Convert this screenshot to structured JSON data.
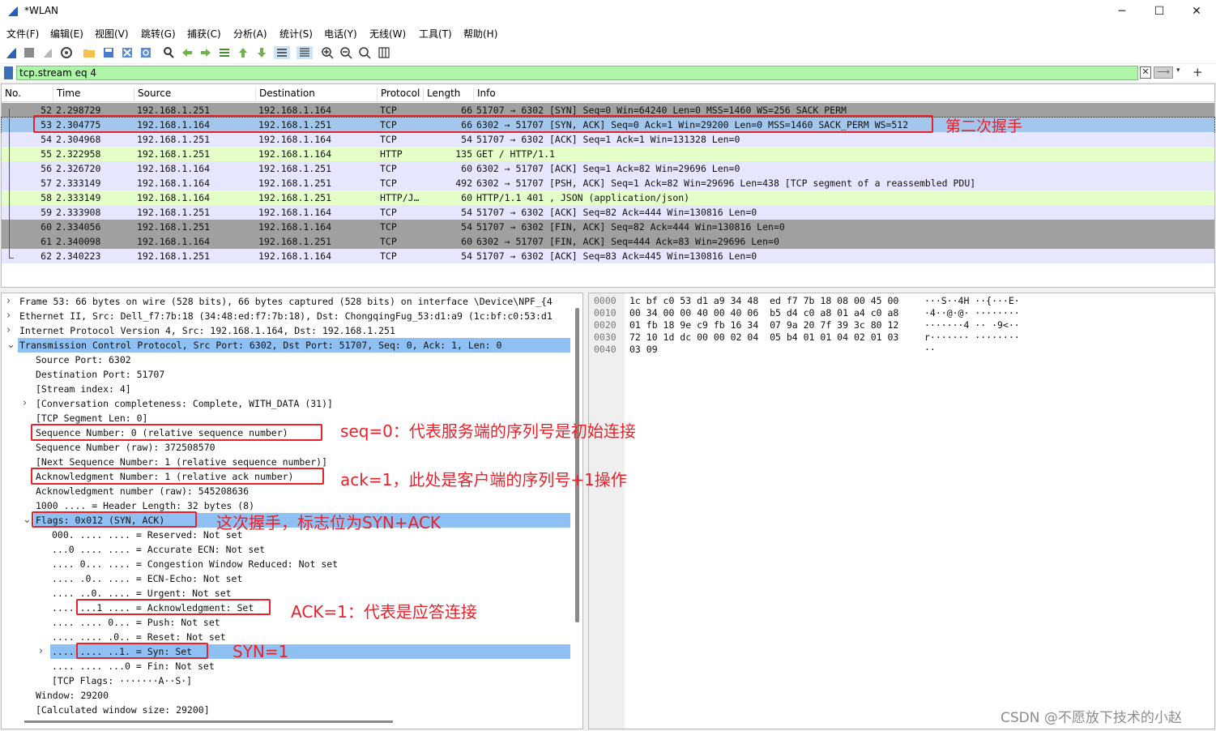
{
  "window": {
    "title": "*WLAN",
    "minimize": "─",
    "maximize": "☐",
    "close": "✕"
  },
  "menu": [
    "文件(F)",
    "编辑(E)",
    "视图(V)",
    "跳转(G)",
    "捕获(C)",
    "分析(A)",
    "统计(S)",
    "电话(Y)",
    "无线(W)",
    "工具(T)",
    "帮助(H)"
  ],
  "toolbar_icons": [
    "shark-fin-start-icon",
    "stop-icon",
    "restart-icon",
    "capture-options-icon",
    "open-folder-icon",
    "save-icon",
    "close-file-icon",
    "reload-icon",
    "find-icon",
    "go-back-icon",
    "go-forward-icon",
    "go-to-packet-icon",
    "go-first-icon",
    "go-last-icon",
    "autoscroll-icon",
    "colorize-icon",
    "zoom-in-icon",
    "zoom-out-icon",
    "zoom-reset-icon",
    "resize-columns-icon"
  ],
  "filter": {
    "value": "tcp.stream eq 4",
    "clear": "✕",
    "apply": "⟶",
    "dropdown": "▾",
    "add": "+"
  },
  "columns": [
    "No.",
    "Time",
    "Source",
    "Destination",
    "Protocol",
    "Length",
    "Info"
  ],
  "packets": [
    {
      "no": "52",
      "time": "2.298729",
      "src": "192.168.1.251",
      "dst": "192.168.1.164",
      "proto": "TCP",
      "len": "66",
      "info": "51707 → 6302 [SYN] Seq=0 Win=64240 Len=0 MSS=1460 WS=256 SACK_PERM",
      "bg": "#a0a0a0",
      "fg": "#111111"
    },
    {
      "no": "53",
      "time": "2.304775",
      "src": "192.168.1.164",
      "dst": "192.168.1.251",
      "proto": "TCP",
      "len": "66",
      "info": "6302 → 51707 [SYN, ACK] Seq=0 Ack=1 Win=29200 Len=0 MSS=1460 SACK_PERM WS=512",
      "bg": "#a2c6ec",
      "fg": "#111111"
    },
    {
      "no": "54",
      "time": "2.304968",
      "src": "192.168.1.251",
      "dst": "192.168.1.164",
      "proto": "TCP",
      "len": "54",
      "info": "51707 → 6302 [ACK] Seq=1 Ack=1 Win=131328 Len=0",
      "bg": "#e7e6ff",
      "fg": "#111111"
    },
    {
      "no": "55",
      "time": "2.322958",
      "src": "192.168.1.251",
      "dst": "192.168.1.164",
      "proto": "HTTP",
      "len": "135",
      "info": "GET / HTTP/1.1",
      "bg": "#e4ffc7",
      "fg": "#111111"
    },
    {
      "no": "56",
      "time": "2.326720",
      "src": "192.168.1.164",
      "dst": "192.168.1.251",
      "proto": "TCP",
      "len": "60",
      "info": "6302 → 51707 [ACK] Seq=1 Ack=82 Win=29696 Len=0",
      "bg": "#e7e6ff",
      "fg": "#111111"
    },
    {
      "no": "57",
      "time": "2.333149",
      "src": "192.168.1.164",
      "dst": "192.168.1.251",
      "proto": "TCP",
      "len": "492",
      "info": "6302 → 51707 [PSH, ACK] Seq=1 Ack=82 Win=29696 Len=438 [TCP segment of a reassembled PDU]",
      "bg": "#e7e6ff",
      "fg": "#111111"
    },
    {
      "no": "58",
      "time": "2.333149",
      "src": "192.168.1.164",
      "dst": "192.168.1.251",
      "proto": "HTTP/J…",
      "len": "60",
      "info": "HTTP/1.1 401  , JSON (application/json)",
      "bg": "#e4ffc7",
      "fg": "#111111"
    },
    {
      "no": "59",
      "time": "2.333908",
      "src": "192.168.1.251",
      "dst": "192.168.1.164",
      "proto": "TCP",
      "len": "54",
      "info": "51707 → 6302 [ACK] Seq=82 Ack=444 Win=130816 Len=0",
      "bg": "#e7e6ff",
      "fg": "#111111"
    },
    {
      "no": "60",
      "time": "2.334056",
      "src": "192.168.1.251",
      "dst": "192.168.1.164",
      "proto": "TCP",
      "len": "54",
      "info": "51707 → 6302 [FIN, ACK] Seq=82 Ack=444 Win=130816 Len=0",
      "bg": "#a0a0a0",
      "fg": "#111111"
    },
    {
      "no": "61",
      "time": "2.340098",
      "src": "192.168.1.164",
      "dst": "192.168.1.251",
      "proto": "TCP",
      "len": "60",
      "info": "6302 → 51707 [FIN, ACK] Seq=444 Ack=83 Win=29696 Len=0",
      "bg": "#a0a0a0",
      "fg": "#111111"
    },
    {
      "no": "62",
      "time": "2.340223",
      "src": "192.168.1.251",
      "dst": "192.168.1.164",
      "proto": "TCP",
      "len": "54",
      "info": "51707 → 6302 [ACK] Seq=83 Ack=445 Win=130816 Len=0",
      "bg": "#e7e6ff",
      "fg": "#111111"
    }
  ],
  "details": [
    {
      "text": "Frame 53: 66 bytes on wire (528 bits), 66 bytes captured (528 bits) on interface \\Device\\NPF_{4",
      "arrow": "›",
      "selected": false
    },
    {
      "text": "Ethernet II, Src: Dell_f7:7b:18 (34:48:ed:f7:7b:18), Dst: ChongqingFug_53:d1:a9 (1c:bf:c0:53:d1",
      "arrow": "›",
      "selected": false
    },
    {
      "text": "Internet Protocol Version 4, Src: 192.168.1.164, Dst: 192.168.1.251",
      "arrow": "›",
      "selected": false
    },
    {
      "text": "Transmission Control Protocol, Src Port: 6302, Dst Port: 51707, Seq: 0, Ack: 1, Len: 0",
      "arrow": "⌄",
      "selected": true
    },
    {
      "text": "Source Port: 6302",
      "arrow": "",
      "selected": false
    },
    {
      "text": "Destination Port: 51707",
      "arrow": "",
      "selected": false
    },
    {
      "text": "[Stream index: 4]",
      "arrow": "",
      "selected": false
    },
    {
      "text": "[Conversation completeness: Complete, WITH_DATA (31)]",
      "arrow": "›",
      "selected": false
    },
    {
      "text": "[TCP Segment Len: 0]",
      "arrow": "",
      "selected": false
    },
    {
      "text": "Sequence Number: 0    (relative sequence number)",
      "arrow": "",
      "selected": false
    },
    {
      "text": "Sequence Number (raw): 372508570",
      "arrow": "",
      "selected": false
    },
    {
      "text": "[Next Sequence Number: 1    (relative sequence number)]",
      "arrow": "",
      "selected": false
    },
    {
      "text": "Acknowledgment Number: 1    (relative ack number)",
      "arrow": "",
      "selected": false
    },
    {
      "text": "Acknowledgment number (raw): 545208636",
      "arrow": "",
      "selected": false
    },
    {
      "text": "1000 .... = Header Length: 32 bytes (8)",
      "arrow": "",
      "selected": false
    },
    {
      "text": "Flags: 0x012 (SYN, ACK)",
      "arrow": "⌄",
      "selected": true
    },
    {
      "text": "000. .... .... = Reserved: Not set",
      "arrow": "",
      "selected": false
    },
    {
      "text": "...0 .... .... = Accurate ECN: Not set",
      "arrow": "",
      "selected": false
    },
    {
      "text": ".... 0... .... = Congestion Window Reduced: Not set",
      "arrow": "",
      "selected": false
    },
    {
      "text": ".... .0.. .... = ECN-Echo: Not set",
      "arrow": "",
      "selected": false
    },
    {
      "text": ".... ..0. .... = Urgent: Not set",
      "arrow": "",
      "selected": false
    },
    {
      "text": ".... ...1 .... = Acknowledgment: Set",
      "arrow": "",
      "selected": false
    },
    {
      "text": ".... .... 0... = Push: Not set",
      "arrow": "",
      "selected": false
    },
    {
      "text": ".... .... .0.. = Reset: Not set",
      "arrow": "",
      "selected": false
    },
    {
      "text": ".... .... ..1. = Syn: Set",
      "arrow": "›",
      "selected": true
    },
    {
      "text": ".... .... ...0 = Fin: Not set",
      "arrow": "",
      "selected": false
    },
    {
      "text": "[TCP Flags: ·······A··S·]",
      "arrow": "",
      "selected": false
    },
    {
      "text": "Window: 29200",
      "arrow": "",
      "selected": false
    },
    {
      "text": "[Calculated window size: 29200]",
      "arrow": "",
      "selected": false
    }
  ],
  "hex": [
    {
      "offset": "0000",
      "bytes": "1c bf c0 53 d1 a9 34 48  ed f7 7b 18 08 00 45 00",
      "ascii": "···S··4H ··{···E·"
    },
    {
      "offset": "0010",
      "bytes": "00 34 00 00 40 00 40 06  b5 d4 c0 a8 01 a4 c0 a8",
      "ascii": "·4··@·@· ········"
    },
    {
      "offset": "0020",
      "bytes": "01 fb 18 9e c9 fb 16 34  07 9a 20 7f 39 3c 80 12",
      "ascii": "·······4 ·· ·9<··"
    },
    {
      "offset": "0030",
      "bytes": "72 10 1d dc 00 00 02 04  05 b4 01 01 04 02 01 03",
      "ascii": "r······· ········"
    },
    {
      "offset": "0040",
      "bytes": "03 09",
      "ascii": "··"
    }
  ],
  "annotations": {
    "second_handshake": "第二次握手",
    "seq": "seq=0：代表服务端的序列号是初始连接",
    "ack": "ack=1，此处是客户端的序列号+1操作",
    "flags": "这次握手，标志位为SYN+ACK",
    "ack_flag": "ACK=1：代表是应答连接",
    "syn": "SYN=1"
  },
  "watermark": "CSDN @不愿放下技术的小赵",
  "colors": {
    "selected": "#8ec0f3",
    "annotation": "#e8222b",
    "filter_ok": "#aff5a9"
  }
}
